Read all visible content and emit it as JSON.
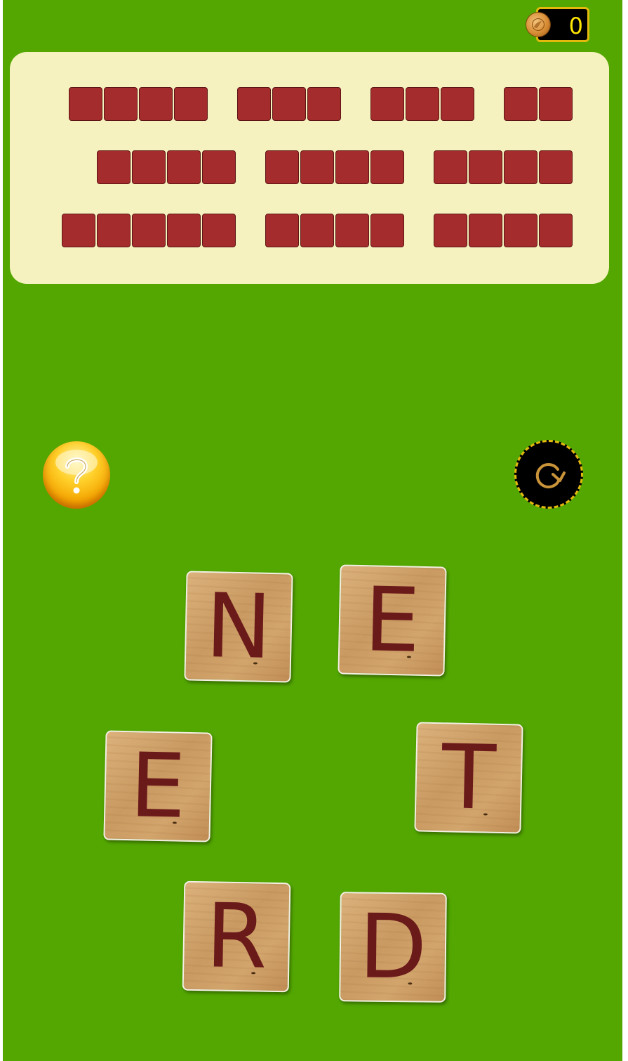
{
  "coins": {
    "count": "0"
  },
  "answer_board": {
    "rows": [
      [
        4,
        3,
        3,
        2
      ],
      [
        4,
        4,
        4
      ],
      [
        5,
        4,
        4
      ]
    ]
  },
  "tiles": [
    {
      "letter": "N"
    },
    {
      "letter": "E"
    },
    {
      "letter": "E"
    },
    {
      "letter": "T"
    },
    {
      "letter": "R"
    },
    {
      "letter": "D"
    }
  ],
  "colors": {
    "background": "#53a700",
    "board": "#f6f2bf",
    "slot": "#a52c2c",
    "letter": "#6b1a1a",
    "counter_text": "#ffe600",
    "counter_border": "#e3b90e"
  },
  "icons": {
    "hint": "question-mark-icon",
    "shuffle": "refresh-icon",
    "coin": "coin-icon"
  }
}
